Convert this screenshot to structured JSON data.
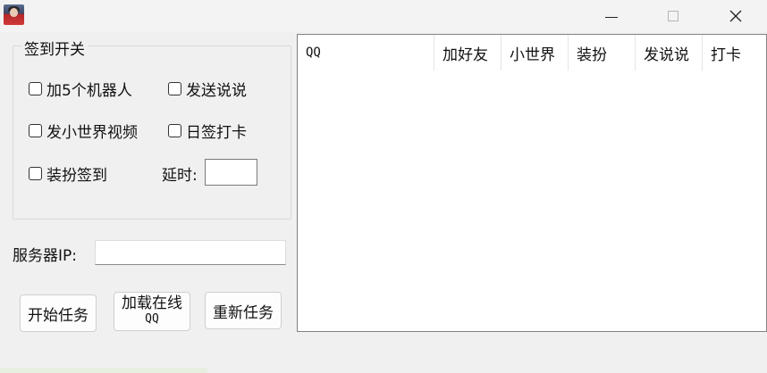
{
  "window": {
    "title": "",
    "controls": {
      "minimize": "minimize",
      "maximize": "maximize",
      "close": "close"
    }
  },
  "checkin_group": {
    "title": "签到开关",
    "checkboxes": [
      {
        "label": "加5个机器人",
        "checked": false
      },
      {
        "label": "发送说说",
        "checked": false
      },
      {
        "label": "发小世界视频",
        "checked": false
      },
      {
        "label": "日签打卡",
        "checked": false
      },
      {
        "label": "装扮签到",
        "checked": false
      }
    ],
    "delay_label": "延时:",
    "delay_value": ""
  },
  "server": {
    "label": "服务器IP:",
    "value": ""
  },
  "buttons": {
    "start": "开始任务",
    "load_line1": "加载在线",
    "load_line2": "QQ",
    "restart": "重新任务"
  },
  "list": {
    "columns": [
      "QQ",
      "加好友",
      "小世界",
      "装扮",
      "发说说",
      "打卡"
    ],
    "rows": []
  },
  "icons": {
    "app": "app-avatar-icon",
    "close": "close-icon",
    "minimize": "minimize-icon",
    "maximize": "maximize-icon"
  }
}
